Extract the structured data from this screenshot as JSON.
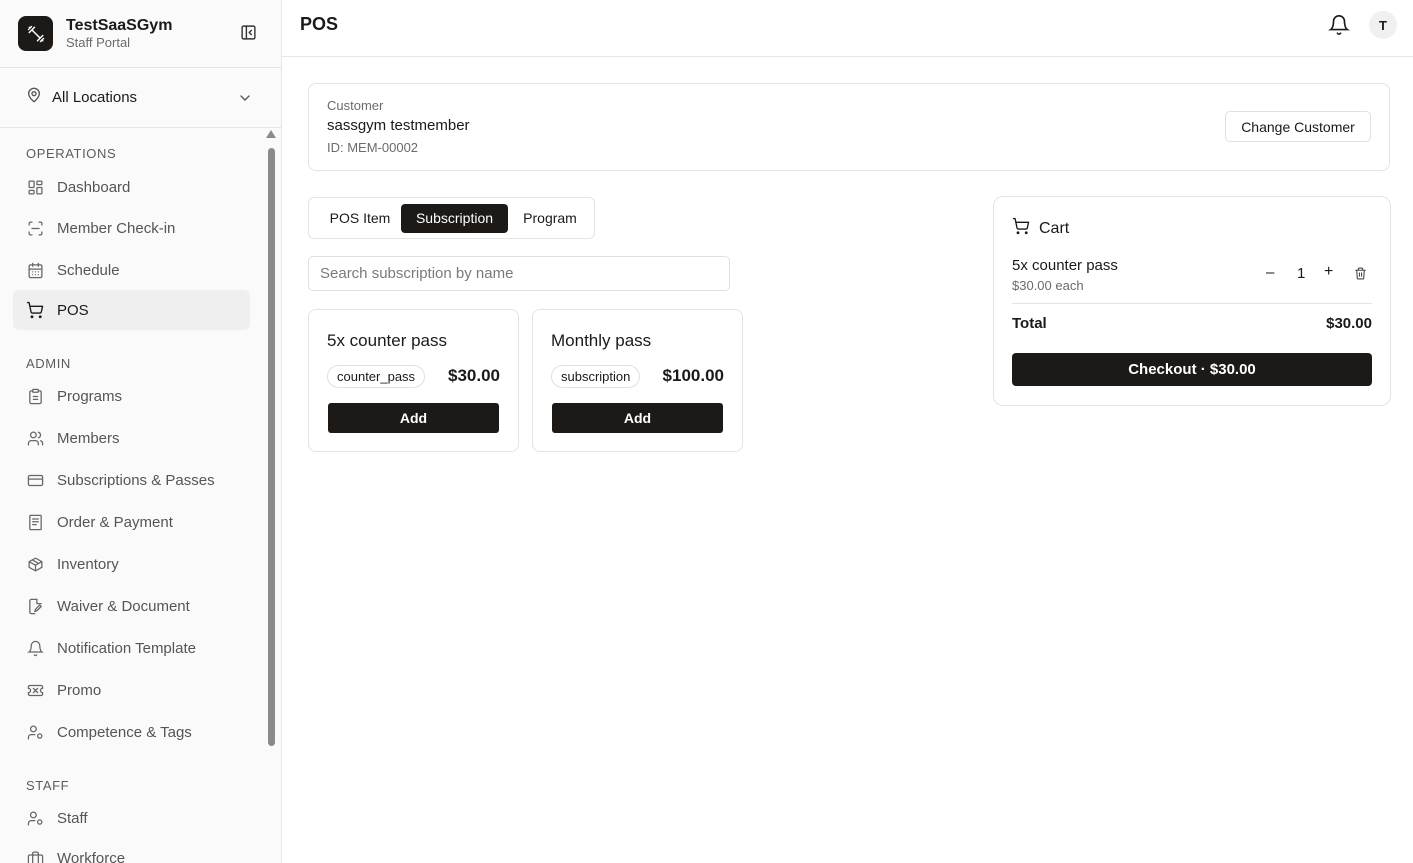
{
  "brand": {
    "name": "TestSaaSGym",
    "subtitle": "Staff Portal"
  },
  "location": {
    "label": "All Locations"
  },
  "nav": {
    "sections": [
      {
        "title": "OPERATIONS",
        "items": [
          {
            "label": "Dashboard",
            "icon": "dashboard-icon"
          },
          {
            "label": "Member Check-in",
            "icon": "scan-icon"
          },
          {
            "label": "Schedule",
            "icon": "calendar-icon"
          },
          {
            "label": "POS",
            "icon": "cart-icon",
            "active": true
          }
        ]
      },
      {
        "title": "ADMIN",
        "items": [
          {
            "label": "Programs",
            "icon": "clipboard-icon"
          },
          {
            "label": "Members",
            "icon": "users-icon"
          },
          {
            "label": "Subscriptions & Passes",
            "icon": "credit-card-icon"
          },
          {
            "label": "Order & Payment",
            "icon": "receipt-icon"
          },
          {
            "label": "Inventory",
            "icon": "package-icon"
          },
          {
            "label": "Waiver & Document",
            "icon": "file-edit-icon"
          },
          {
            "label": "Notification Template",
            "icon": "bell-icon"
          },
          {
            "label": "Promo",
            "icon": "ticket-icon"
          },
          {
            "label": "Competence & Tags",
            "icon": "user-cog-icon"
          }
        ]
      },
      {
        "title": "STAFF",
        "items": [
          {
            "label": "Staff",
            "icon": "user-cog-icon"
          },
          {
            "label": "Workforce",
            "icon": "briefcase-icon"
          }
        ]
      }
    ]
  },
  "header": {
    "title": "POS",
    "avatar_initial": "T"
  },
  "customer": {
    "label": "Customer",
    "name": "sassgym testmember",
    "id": "ID: MEM-00002",
    "change_label": "Change Customer"
  },
  "tabs": [
    {
      "label": "POS Item"
    },
    {
      "label": "Subscription",
      "active": true
    },
    {
      "label": "Program"
    }
  ],
  "search": {
    "placeholder": "Search subscription by name"
  },
  "products": [
    {
      "name": "5x counter pass",
      "tag": "counter_pass",
      "price": "$30.00",
      "add_label": "Add"
    },
    {
      "name": "Monthly pass",
      "tag": "subscription",
      "price": "$100.00",
      "add_label": "Add"
    }
  ],
  "cart": {
    "title": "Cart",
    "items": [
      {
        "name": "5x counter pass",
        "each": "$30.00 each",
        "qty": "1",
        "minus": "–",
        "plus": "+"
      }
    ],
    "total_label": "Total",
    "total_value": "$30.00",
    "checkout_label": "Checkout · $30.00"
  },
  "colors": {
    "primary": "#1c1917",
    "border": "#e3e3e3",
    "muted_text": "#6b6b6b",
    "active_nav_bg": "#efefef"
  }
}
